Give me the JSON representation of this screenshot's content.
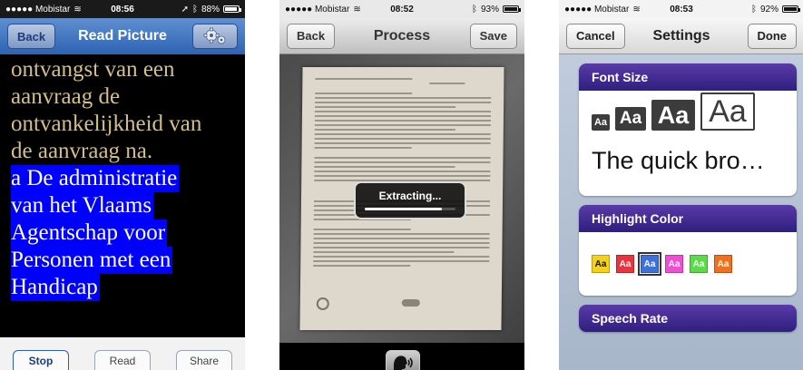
{
  "screen1": {
    "status": {
      "carrier": "●●●●● Mobistar",
      "time": "08:56",
      "battery": "88%",
      "battery_level": 0.88
    },
    "nav": {
      "back": "Back",
      "title": "Read Picture"
    },
    "text_read": [
      "ontvangst van een",
      "aanvraag de",
      "ontvankelijkheid van",
      "de aanvraag na."
    ],
    "text_highlighted": [
      "a De administratie",
      "van het Vlaams",
      "Agentschap voor",
      "Personen met een",
      "Handicap"
    ],
    "toolbar": {
      "stop": "Stop",
      "read": "Read",
      "share": "Share"
    },
    "colors": {
      "read_text": "#d4bf8a",
      "highlight": "#0000ff"
    }
  },
  "screen2": {
    "status": {
      "carrier": "●●●●● Mobistar",
      "time": "08:52",
      "battery": "93%",
      "battery_level": 0.93
    },
    "nav": {
      "back": "Back",
      "title": "Process",
      "save": "Save"
    },
    "extracting": "Extracting...",
    "progress": 0.85
  },
  "screen3": {
    "status": {
      "carrier": "●●●●● Mobistar",
      "time": "08:53",
      "battery": "92%",
      "battery_level": 0.92
    },
    "nav": {
      "cancel": "Cancel",
      "title": "Settings",
      "done": "Done"
    },
    "font_size": {
      "heading": "Font Size",
      "sample_label": "Aa",
      "preview": "The quick bro…"
    },
    "highlight_color": {
      "heading": "Highlight Color",
      "swatches": [
        {
          "label": "Aa",
          "color": "#f2d21c",
          "text": "#111111"
        },
        {
          "label": "Aa",
          "color": "#e8343c",
          "text": "#ffffff"
        },
        {
          "label": "Aa",
          "color": "#3f6fd8",
          "text": "#ffffff",
          "selected": true
        },
        {
          "label": "Aa",
          "color": "#ec4fd4",
          "text": "#ffffff"
        },
        {
          "label": "Aa",
          "color": "#5ed84c",
          "text": "#ffffff"
        },
        {
          "label": "Aa",
          "color": "#f07020",
          "text": "#ffffff"
        }
      ]
    },
    "speech_rate": {
      "heading": "Speech Rate"
    }
  }
}
